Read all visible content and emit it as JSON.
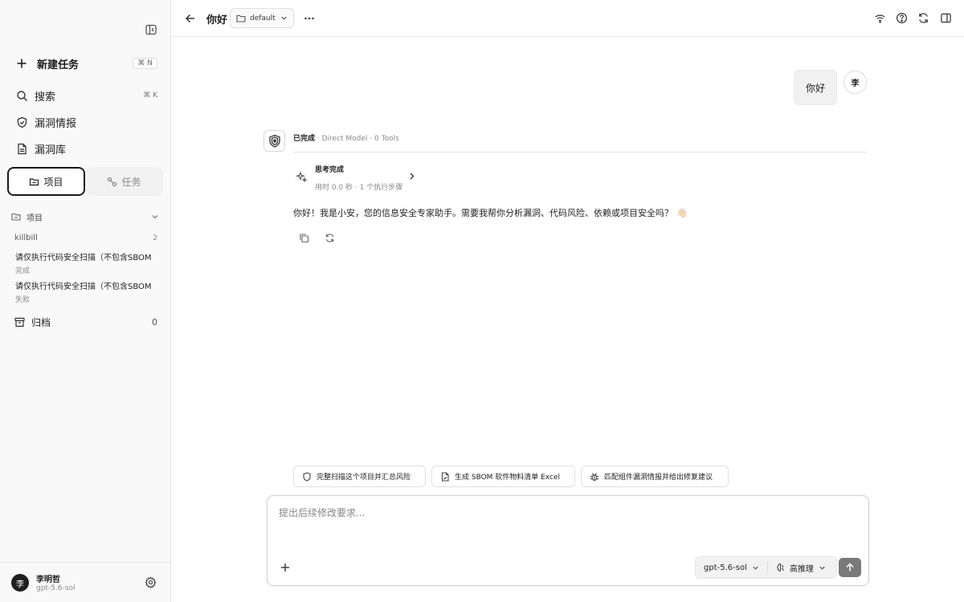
{
  "sidebar": {
    "new_task": {
      "label": "新建任务",
      "shortcut": "⌘ N"
    },
    "nav": [
      {
        "label": "搜索",
        "hint": "⌘ K"
      },
      {
        "label": "漏洞情报"
      },
      {
        "label": "漏洞库"
      }
    ],
    "tabs": [
      {
        "label": "项目",
        "active": true
      },
      {
        "label": "任务",
        "active": false
      }
    ],
    "group": {
      "label": "项目"
    },
    "project": {
      "name": "killbill",
      "count": "2"
    },
    "tasks": [
      {
        "title": "请仅执行代码安全扫描（不包含SBOM",
        "status": "完成"
      },
      {
        "title": "请仅执行代码安全扫描（不包含SBOM",
        "status": "失败"
      }
    ],
    "archive": {
      "label": "归档",
      "count": "0"
    },
    "user": {
      "avatar": "李",
      "name": "李明哲",
      "model": "gpt-5.6-sol"
    }
  },
  "header": {
    "title": "你好",
    "project_select": "default"
  },
  "conversation": {
    "user_message": "你好",
    "user_avatar": "李",
    "assistant": {
      "status": "已完成",
      "meta": " · Direct Model · 0 Tools",
      "thinking_title": "思考完成",
      "thinking_sub": "用时 0.0 秒 · 1 个执行步骤",
      "message": "你好！我是小安，您的信息安全专家助手。需要我帮你分析漏洞、代码风险、依赖或项目安全吗？",
      "emoji": "👋🏻"
    }
  },
  "suggestions": [
    "完整扫描这个项目并汇总风险",
    "生成 SBOM 软件物料清单 Excel",
    "匹配组件漏洞情报并给出修复建议"
  ],
  "composer": {
    "placeholder": "提出后续修改要求...",
    "value": "",
    "model": "gpt-5.6-sol",
    "reasoning": "高推理"
  }
}
